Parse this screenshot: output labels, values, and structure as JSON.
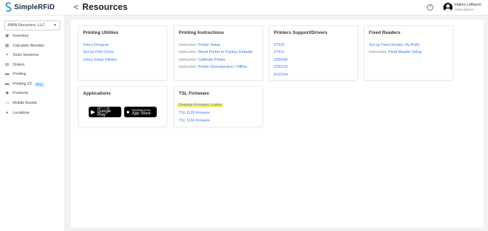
{
  "app": {
    "logo_text": "SimpleRFiD",
    "page_title": "Resources",
    "back_glyph": "<"
  },
  "header": {
    "help_glyph": "?",
    "user_name": "Hailey LeBaron",
    "user_role": "Administrator"
  },
  "sidebar": {
    "org_select": {
      "value": "BMW Recyclers, LLC"
    },
    "items": [
      {
        "label": "Inventory",
        "icon": "inventory-icon"
      },
      {
        "label": "Calculate Reorder",
        "icon": "grid-icon"
      },
      {
        "label": "Scan Sessions",
        "icon": "scan-icon"
      },
      {
        "label": "Orders",
        "icon": "orders-icon"
      },
      {
        "label": "Printing",
        "icon": "printer-icon"
      },
      {
        "label": "Printing V2",
        "icon": "printer-icon",
        "badge": "New"
      },
      {
        "label": "Products",
        "icon": "tag-icon"
      },
      {
        "label": "Mobile Assets",
        "icon": "mobile-icon"
      },
      {
        "label": "Locations",
        "icon": "location-pin-icon"
      }
    ]
  },
  "cards": {
    "printing_utilities": {
      "title": "Printing Utilities",
      "links": [
        "Zebra Designer",
        "Set-up Print Client",
        "Zebra Setup Utilities"
      ]
    },
    "printing_instructions": {
      "title": "Printing Instructions",
      "prefix": "Instruction:",
      "links": [
        "Printer Setup",
        "Reset Printer to Factory Defaults",
        "Calibrate Printer",
        "Printer Unresponsive / Offline"
      ]
    },
    "printers_support": {
      "title": "Printers Support/Drivers",
      "links": [
        "ZT410",
        "ZT411",
        "ZD500R",
        "ZD621R",
        "R110Xi4"
      ]
    },
    "fixed_readers": {
      "title": "Fixed Readers",
      "line1": "Set-up Fixed Reader (ALPHA)",
      "line2_prefix": "Instruction:",
      "line2_link": "Fixed Reader Setup"
    },
    "applications": {
      "title": "Applications",
      "google_play": {
        "small": "GET IT ON",
        "big": "Google Play"
      },
      "app_store": {
        "small": "Download on the",
        "big": "App Store"
      }
    },
    "tsl_firmware": {
      "title": "TSL Firmware",
      "links": [
        "Desktop Firmware Loader",
        "TSL 1128 firmware",
        "TSL 1166 firmware"
      ]
    }
  },
  "colors": {
    "link": "#2f7be5",
    "highlight": "#fff36b",
    "brand_navy": "#1a2a48"
  }
}
